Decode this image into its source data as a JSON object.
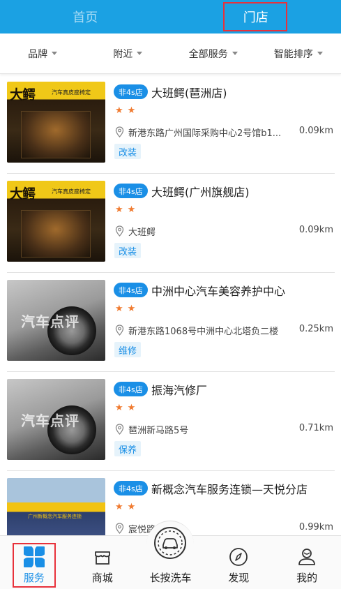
{
  "top_tabs": [
    {
      "label": "首页",
      "active": false
    },
    {
      "label": "门店",
      "active": true
    }
  ],
  "filters": [
    {
      "label": "品牌"
    },
    {
      "label": "附近"
    },
    {
      "label": "全部服务"
    },
    {
      "label": "智能排序"
    }
  ],
  "stores": [
    {
      "badge": "非4s店",
      "name": "大班鳄(琶洲店)",
      "stars": 2,
      "address": "新港东路广州国际采购中心2号馆b1...",
      "distance": "0.09km",
      "tag": "改装",
      "thumb_sign": "大鳄",
      "thumb_sub": "汽车真皮座椅定"
    },
    {
      "badge": "非4s店",
      "name": "大班鳄(广州旗舰店)",
      "stars": 2,
      "address": "大班鳄",
      "distance": "0.09km",
      "tag": "改装",
      "thumb_sign": "大鳄",
      "thumb_sub": "汽车真皮座椅定"
    },
    {
      "badge": "非4s店",
      "name": "中洲中心汽车美容养护中心",
      "stars": 2,
      "address": "新港东路1068号中洲中心北塔负二楼",
      "distance": "0.25km",
      "tag": "维修",
      "thumb_watermark": "汽车点评"
    },
    {
      "badge": "非4s店",
      "name": "振海汽修厂",
      "stars": 2,
      "address": "琶洲新马路5号",
      "distance": "0.71km",
      "tag": "保养",
      "thumb_watermark": "汽车点评"
    },
    {
      "badge": "非4s店",
      "name": "新概念汽车服务连锁—天悦分店",
      "stars": 2,
      "address": "宸悦路2号",
      "distance": "0.99km",
      "tag": "",
      "thumb_sign": "广州新概念汽车服务连锁"
    }
  ],
  "bottom_nav": [
    {
      "label": "服务",
      "icon": "service-icon",
      "active": true
    },
    {
      "label": "商城",
      "icon": "shop-icon",
      "active": false
    },
    {
      "label": "长按洗车",
      "icon": "car-wash-icon",
      "active": false
    },
    {
      "label": "发现",
      "icon": "compass-icon",
      "active": false
    },
    {
      "label": "我的",
      "icon": "profile-icon",
      "active": false
    }
  ],
  "colors": {
    "primary": "#1ba1e3",
    "accent_blue": "#1a8fe6",
    "star": "#f07a2f",
    "highlight_red": "#e8313b"
  }
}
